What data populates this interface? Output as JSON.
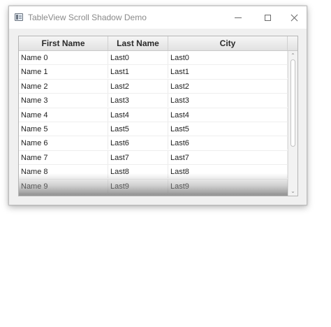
{
  "window": {
    "title": "TableView Scroll Shadow Demo",
    "icon": "app-window-icon",
    "controls": {
      "minimize_icon": "minimize-icon",
      "maximize_icon": "maximize-icon",
      "close_icon": "close-icon"
    }
  },
  "table": {
    "columns": [
      "First Name",
      "Last Name",
      "City"
    ],
    "rows": [
      [
        "Name 0",
        "Last0",
        "Last0"
      ],
      [
        "Name 1",
        "Last1",
        "Last1"
      ],
      [
        "Name 2",
        "Last2",
        "Last2"
      ],
      [
        "Name 3",
        "Last3",
        "Last3"
      ],
      [
        "Name 4",
        "Last4",
        "Last4"
      ],
      [
        "Name 5",
        "Last5",
        "Last5"
      ],
      [
        "Name 6",
        "Last6",
        "Last6"
      ],
      [
        "Name 7",
        "Last7",
        "Last7"
      ],
      [
        "Name 8",
        "Last8",
        "Last8"
      ],
      [
        "Name 9",
        "Last9",
        "Last9"
      ]
    ],
    "scrollbar": {
      "up_icon": "scroll-up-arrow-icon",
      "down_icon": "scroll-down-arrow-icon",
      "up_glyph": "⌃",
      "down_glyph": "⌄"
    }
  }
}
